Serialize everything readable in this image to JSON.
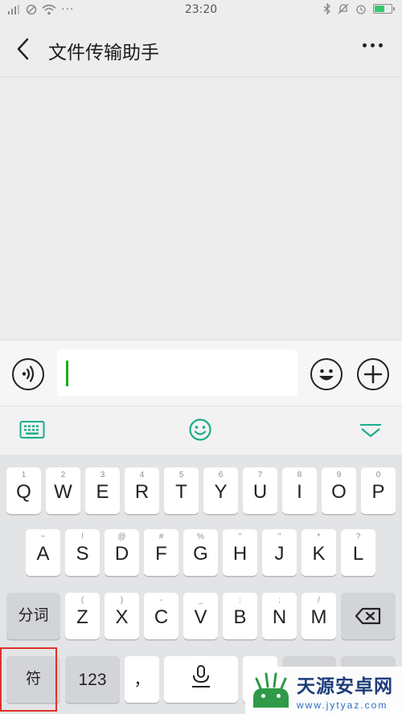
{
  "status_bar": {
    "time": "23:20",
    "left_icons": [
      "signal-icon",
      "do-not-disturb-icon",
      "wifi-icon",
      "more-dots-icon"
    ],
    "right_icons": [
      "bluetooth-icon",
      "mute-bell-icon",
      "alarm-icon",
      "battery-icon"
    ]
  },
  "header": {
    "title": "文件传输助手",
    "back_icon": "back-arrow-icon",
    "more_icon": "more-icon"
  },
  "input_bar": {
    "voice_icon": "voice-icon",
    "text_value": "",
    "emoji_icon": "emoji-icon",
    "plus_icon": "plus-icon"
  },
  "keyboard_toolbar": {
    "icons": [
      "keyboard-icon",
      "smiley-icon",
      "collapse-icon"
    ],
    "accent": "#1aad8a"
  },
  "keyboard": {
    "row1": [
      {
        "main": "Q",
        "sub": "1"
      },
      {
        "main": "W",
        "sub": "2"
      },
      {
        "main": "E",
        "sub": "3"
      },
      {
        "main": "R",
        "sub": "4"
      },
      {
        "main": "T",
        "sub": "5"
      },
      {
        "main": "Y",
        "sub": "6"
      },
      {
        "main": "U",
        "sub": "7"
      },
      {
        "main": "I",
        "sub": "8"
      },
      {
        "main": "O",
        "sub": "9"
      },
      {
        "main": "P",
        "sub": "0"
      }
    ],
    "row2": [
      {
        "main": "A",
        "sub": "~"
      },
      {
        "main": "S",
        "sub": "!"
      },
      {
        "main": "D",
        "sub": "@"
      },
      {
        "main": "F",
        "sub": "#"
      },
      {
        "main": "G",
        "sub": "%"
      },
      {
        "main": "H",
        "sub": "\""
      },
      {
        "main": "J",
        "sub": "\""
      },
      {
        "main": "K",
        "sub": "*"
      },
      {
        "main": "L",
        "sub": "?"
      }
    ],
    "row3_left": "分词",
    "row3": [
      {
        "main": "Z",
        "sub": "("
      },
      {
        "main": "X",
        "sub": ")"
      },
      {
        "main": "C",
        "sub": "-"
      },
      {
        "main": "V",
        "sub": "_"
      },
      {
        "main": "B",
        "sub": ":"
      },
      {
        "main": "N",
        "sub": ";"
      },
      {
        "main": "M",
        "sub": "/"
      }
    ],
    "row3_right_icon": "backspace-icon",
    "row4": {
      "symbols": "符",
      "numbers": "123",
      "comma": "，",
      "mic_icon": "microphone-icon"
    }
  },
  "watermark": {
    "name": "天源安卓网",
    "url": "www.jytyaz.com"
  }
}
